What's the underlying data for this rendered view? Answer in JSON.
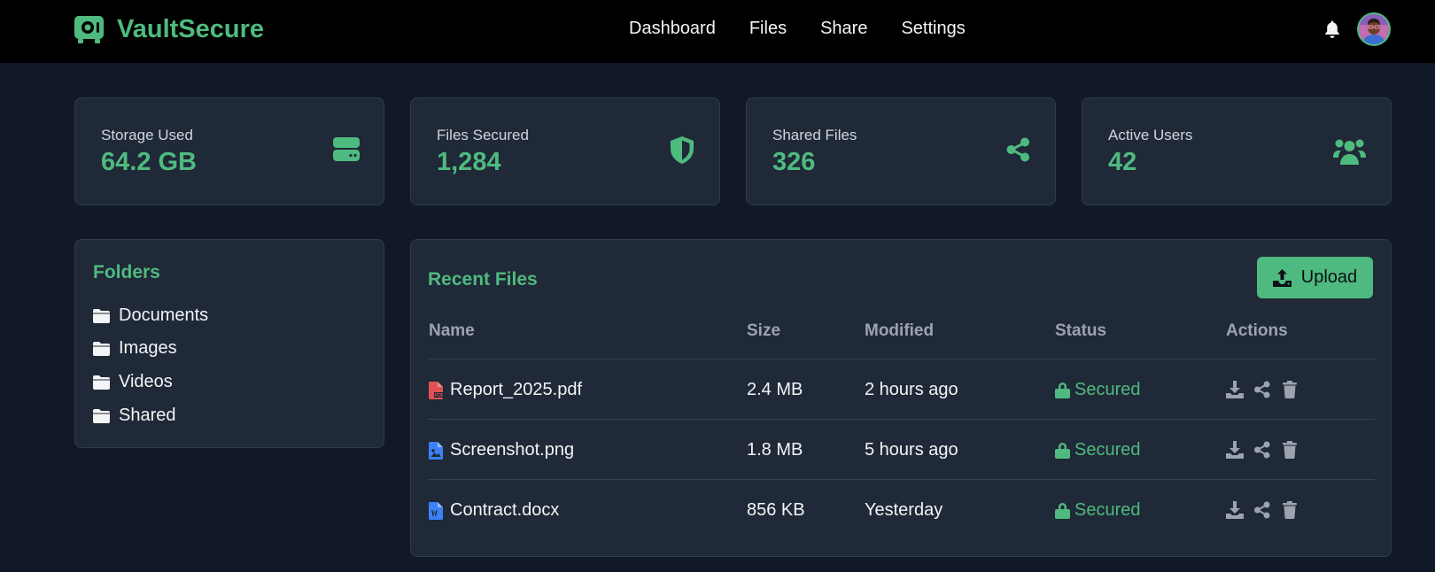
{
  "header": {
    "brand": "VaultSecure",
    "nav": [
      "Dashboard",
      "Files",
      "Share",
      "Settings"
    ]
  },
  "stats": [
    {
      "label": "Storage Used",
      "value": "64.2 GB",
      "icon": "hard-drive-icon"
    },
    {
      "label": "Files Secured",
      "value": "1,284",
      "icon": "shield-icon"
    },
    {
      "label": "Shared Files",
      "value": "326",
      "icon": "share-icon"
    },
    {
      "label": "Active Users",
      "value": "42",
      "icon": "users-icon"
    }
  ],
  "folders": {
    "title": "Folders",
    "items": [
      "Documents",
      "Images",
      "Videos",
      "Shared"
    ]
  },
  "recent": {
    "title": "Recent Files",
    "upload_label": "Upload",
    "columns": [
      "Name",
      "Size",
      "Modified",
      "Status",
      "Actions"
    ],
    "rows": [
      {
        "name": "Report_2025.pdf",
        "size": "2.4 MB",
        "modified": "2 hours ago",
        "status": "Secured",
        "icon": "pdf-file-icon"
      },
      {
        "name": "Screenshot.png",
        "size": "1.8 MB",
        "modified": "5 hours ago",
        "status": "Secured",
        "icon": "image-file-icon"
      },
      {
        "name": "Contract.docx",
        "size": "856 KB",
        "modified": "Yesterday",
        "status": "Secured",
        "icon": "word-file-icon"
      }
    ]
  },
  "colors": {
    "accent": "#4fba7f",
    "background": "#111827",
    "card": "#1f2937",
    "topbar": "#000000",
    "pdf_icon": "#e05252",
    "doc_icon": "#3b82f6"
  }
}
